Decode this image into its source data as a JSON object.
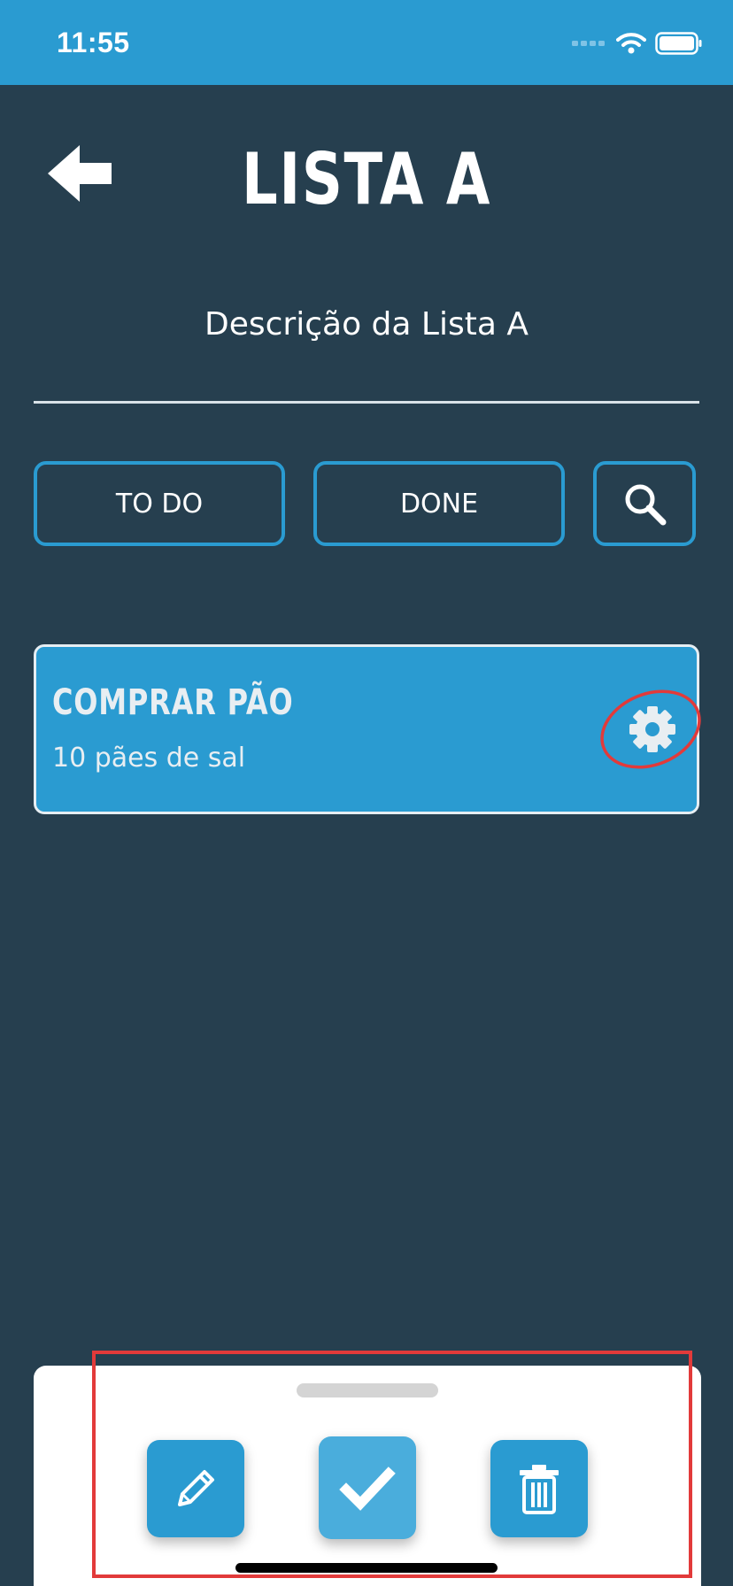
{
  "status_bar": {
    "time": "11:55",
    "icons": [
      "signal-dots-icon",
      "wifi-icon",
      "battery-icon"
    ]
  },
  "header": {
    "back_icon": "arrow-left-icon",
    "title": "LISTA A",
    "subtitle": "Descrição da Lista A"
  },
  "filters": {
    "todo_label": "TO DO",
    "done_label": "DONE",
    "search_icon": "search-icon"
  },
  "tasks": [
    {
      "title": "COMPRAR PÃO",
      "description": "10 pães de sal",
      "settings_icon": "gear-icon"
    }
  ],
  "action_sheet": {
    "actions": [
      "pencil-icon",
      "check-icon",
      "trash-icon"
    ]
  },
  "colors": {
    "background": "#263f4f",
    "accent": "#2a9bd1",
    "annotation": "#e23a3a"
  }
}
